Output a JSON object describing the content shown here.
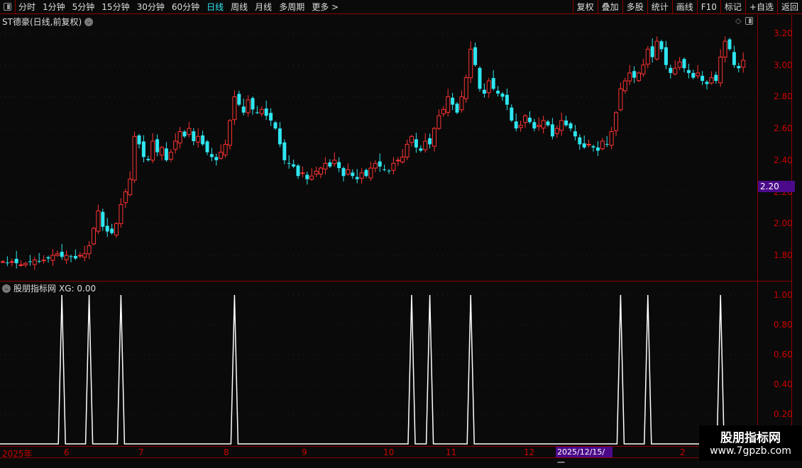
{
  "toolbar": {
    "periods": [
      "分时",
      "1分钟",
      "5分钟",
      "15分钟",
      "30分钟",
      "60分钟",
      "日线",
      "周线",
      "月线",
      "多周期",
      "更多 >"
    ],
    "active_period": "日线",
    "right_buttons": [
      "复权",
      "叠加",
      "多股",
      "统计",
      "画线",
      "F10",
      "标记",
      "+自选",
      "返回"
    ]
  },
  "chart": {
    "title": "ST德豪(日线,前复权)",
    "y_ticks": [
      "3.20",
      "3.00",
      "2.80",
      "2.60",
      "2.40",
      "2.20",
      "2.00",
      "1.80"
    ],
    "current_price_tag": "2.20",
    "up_color": "#ff3232",
    "down_color": "#2ee6f0"
  },
  "indicator": {
    "name": "股朋指标网",
    "readout": "XG: 0.00",
    "y_ticks": [
      "1.00",
      "0.80",
      "0.60",
      "0.40",
      "0.20"
    ],
    "signal_candle_indices": [
      13,
      19,
      26,
      51,
      90,
      94,
      103,
      136,
      142,
      158
    ]
  },
  "x_axis": {
    "labels": [
      "2025年",
      "6",
      "7",
      "8",
      "9",
      "10",
      "11",
      "12",
      "2"
    ],
    "cursor_date": "2025/12/15/一"
  },
  "chart_data": {
    "type": "candlestick",
    "y_range": [
      1.75,
      3.25
    ],
    "closes": [
      1.76,
      1.75,
      1.76,
      1.75,
      1.74,
      1.75,
      1.76,
      1.77,
      1.76,
      1.77,
      1.78,
      1.8,
      1.81,
      1.79,
      1.8,
      1.79,
      1.78,
      1.8,
      1.81,
      1.86,
      1.97,
      2.08,
      1.98,
      1.95,
      1.94,
      2.0,
      2.12,
      2.2,
      2.28,
      2.55,
      2.5,
      2.42,
      2.4,
      2.52,
      2.45,
      2.48,
      2.4,
      2.45,
      2.52,
      2.58,
      2.55,
      2.6,
      2.52,
      2.55,
      2.5,
      2.45,
      2.42,
      2.4,
      2.45,
      2.5,
      2.65,
      2.8,
      2.75,
      2.7,
      2.78,
      2.72,
      2.7,
      2.72,
      2.68,
      2.65,
      2.6,
      2.5,
      2.4,
      2.38,
      2.36,
      2.3,
      2.32,
      2.28,
      2.3,
      2.33,
      2.35,
      2.38,
      2.36,
      2.4,
      2.35,
      2.3,
      2.34,
      2.3,
      2.28,
      2.32,
      2.3,
      2.35,
      2.38,
      2.36,
      2.34,
      2.33,
      2.38,
      2.4,
      2.42,
      2.5,
      2.55,
      2.48,
      2.46,
      2.52,
      2.5,
      2.6,
      2.68,
      2.72,
      2.8,
      2.75,
      2.7,
      2.8,
      2.92,
      3.1,
      3.0,
      2.85,
      2.82,
      2.9,
      2.85,
      2.82,
      2.8,
      2.75,
      2.65,
      2.6,
      2.62,
      2.68,
      2.64,
      2.6,
      2.62,
      2.65,
      2.62,
      2.55,
      2.6,
      2.65,
      2.62,
      2.6,
      2.55,
      2.5,
      2.48,
      2.5,
      2.48,
      2.46,
      2.52,
      2.5,
      2.58,
      2.7,
      2.85,
      2.9,
      2.95,
      2.92,
      2.95,
      3.0,
      3.1,
      3.05,
      3.15,
      3.1,
      3.0,
      2.95,
      2.98,
      3.02,
      2.98,
      2.95,
      2.92,
      2.95,
      2.9,
      2.88,
      2.92,
      2.9,
      3.05,
      3.15,
      3.1,
      3.0,
      2.98,
      3.03
    ]
  },
  "watermark": {
    "line1": "股朋指标网",
    "line2": "www.7gpzb.com"
  }
}
